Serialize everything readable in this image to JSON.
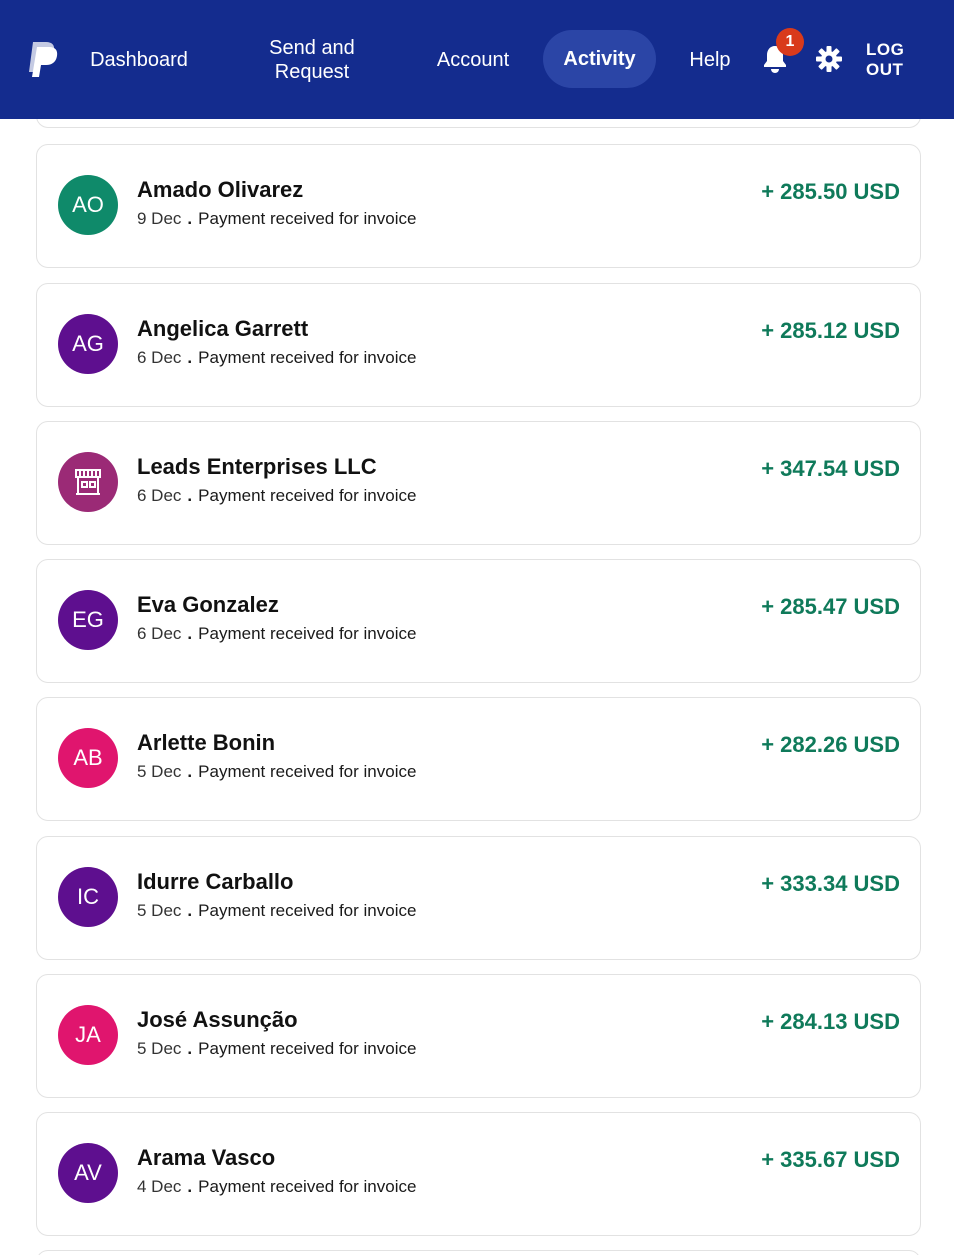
{
  "nav": {
    "dashboard": "Dashboard",
    "send_request": "Send and Request",
    "account": "Account",
    "activity": "Activity",
    "help": "Help",
    "notification_count": "1",
    "logout": "LOG OUT",
    "colors": {
      "bar": "#142c8e",
      "active_pill": "#2b45a6",
      "badge": "#d93a1b"
    }
  },
  "transactions": [
    {
      "initials": "AO",
      "name": "Amado Olivarez",
      "date": "9 Dec",
      "sep": ".",
      "description": "Payment received for invoice",
      "amount": "+ 285.50 USD",
      "avatar_color": "#0f8a6a"
    },
    {
      "initials": "AG",
      "name": "Angelica Garrett",
      "date": "6 Dec",
      "sep": ".",
      "description": "Payment received for invoice",
      "amount": "+ 285.12 USD",
      "avatar_color": "#5e0f8f"
    },
    {
      "initials": "",
      "icon": "storefront-icon",
      "name": "Leads Enterprises LLC",
      "date": "6 Dec",
      "sep": ".",
      "description": "Payment received for invoice",
      "amount": "+ 347.54 USD",
      "avatar_color": "#9b2a76"
    },
    {
      "initials": "EG",
      "name": "Eva Gonzalez",
      "date": "6 Dec",
      "sep": ".",
      "description": "Payment received for invoice",
      "amount": "+ 285.47 USD",
      "avatar_color": "#5e0f8f"
    },
    {
      "initials": "AB",
      "name": "Arlette Bonin",
      "date": "5 Dec",
      "sep": ".",
      "description": "Payment received for invoice",
      "amount": "+ 282.26 USD",
      "avatar_color": "#e0156e"
    },
    {
      "initials": "IC",
      "name": "Idurre Carballo",
      "date": "5 Dec",
      "sep": ".",
      "description": "Payment received for invoice",
      "amount": "+ 333.34 USD",
      "avatar_color": "#5e0f8f"
    },
    {
      "initials": "JA",
      "name": "José Assunção",
      "date": "5 Dec",
      "sep": ".",
      "description": "Payment received for invoice",
      "amount": "+ 284.13 USD",
      "avatar_color": "#e0156e"
    },
    {
      "initials": "AV",
      "name": "Arama Vasco",
      "date": "4 Dec",
      "sep": ".",
      "description": "Payment received for invoice",
      "amount": "+ 335.67 USD",
      "avatar_color": "#5e0f8f"
    }
  ]
}
